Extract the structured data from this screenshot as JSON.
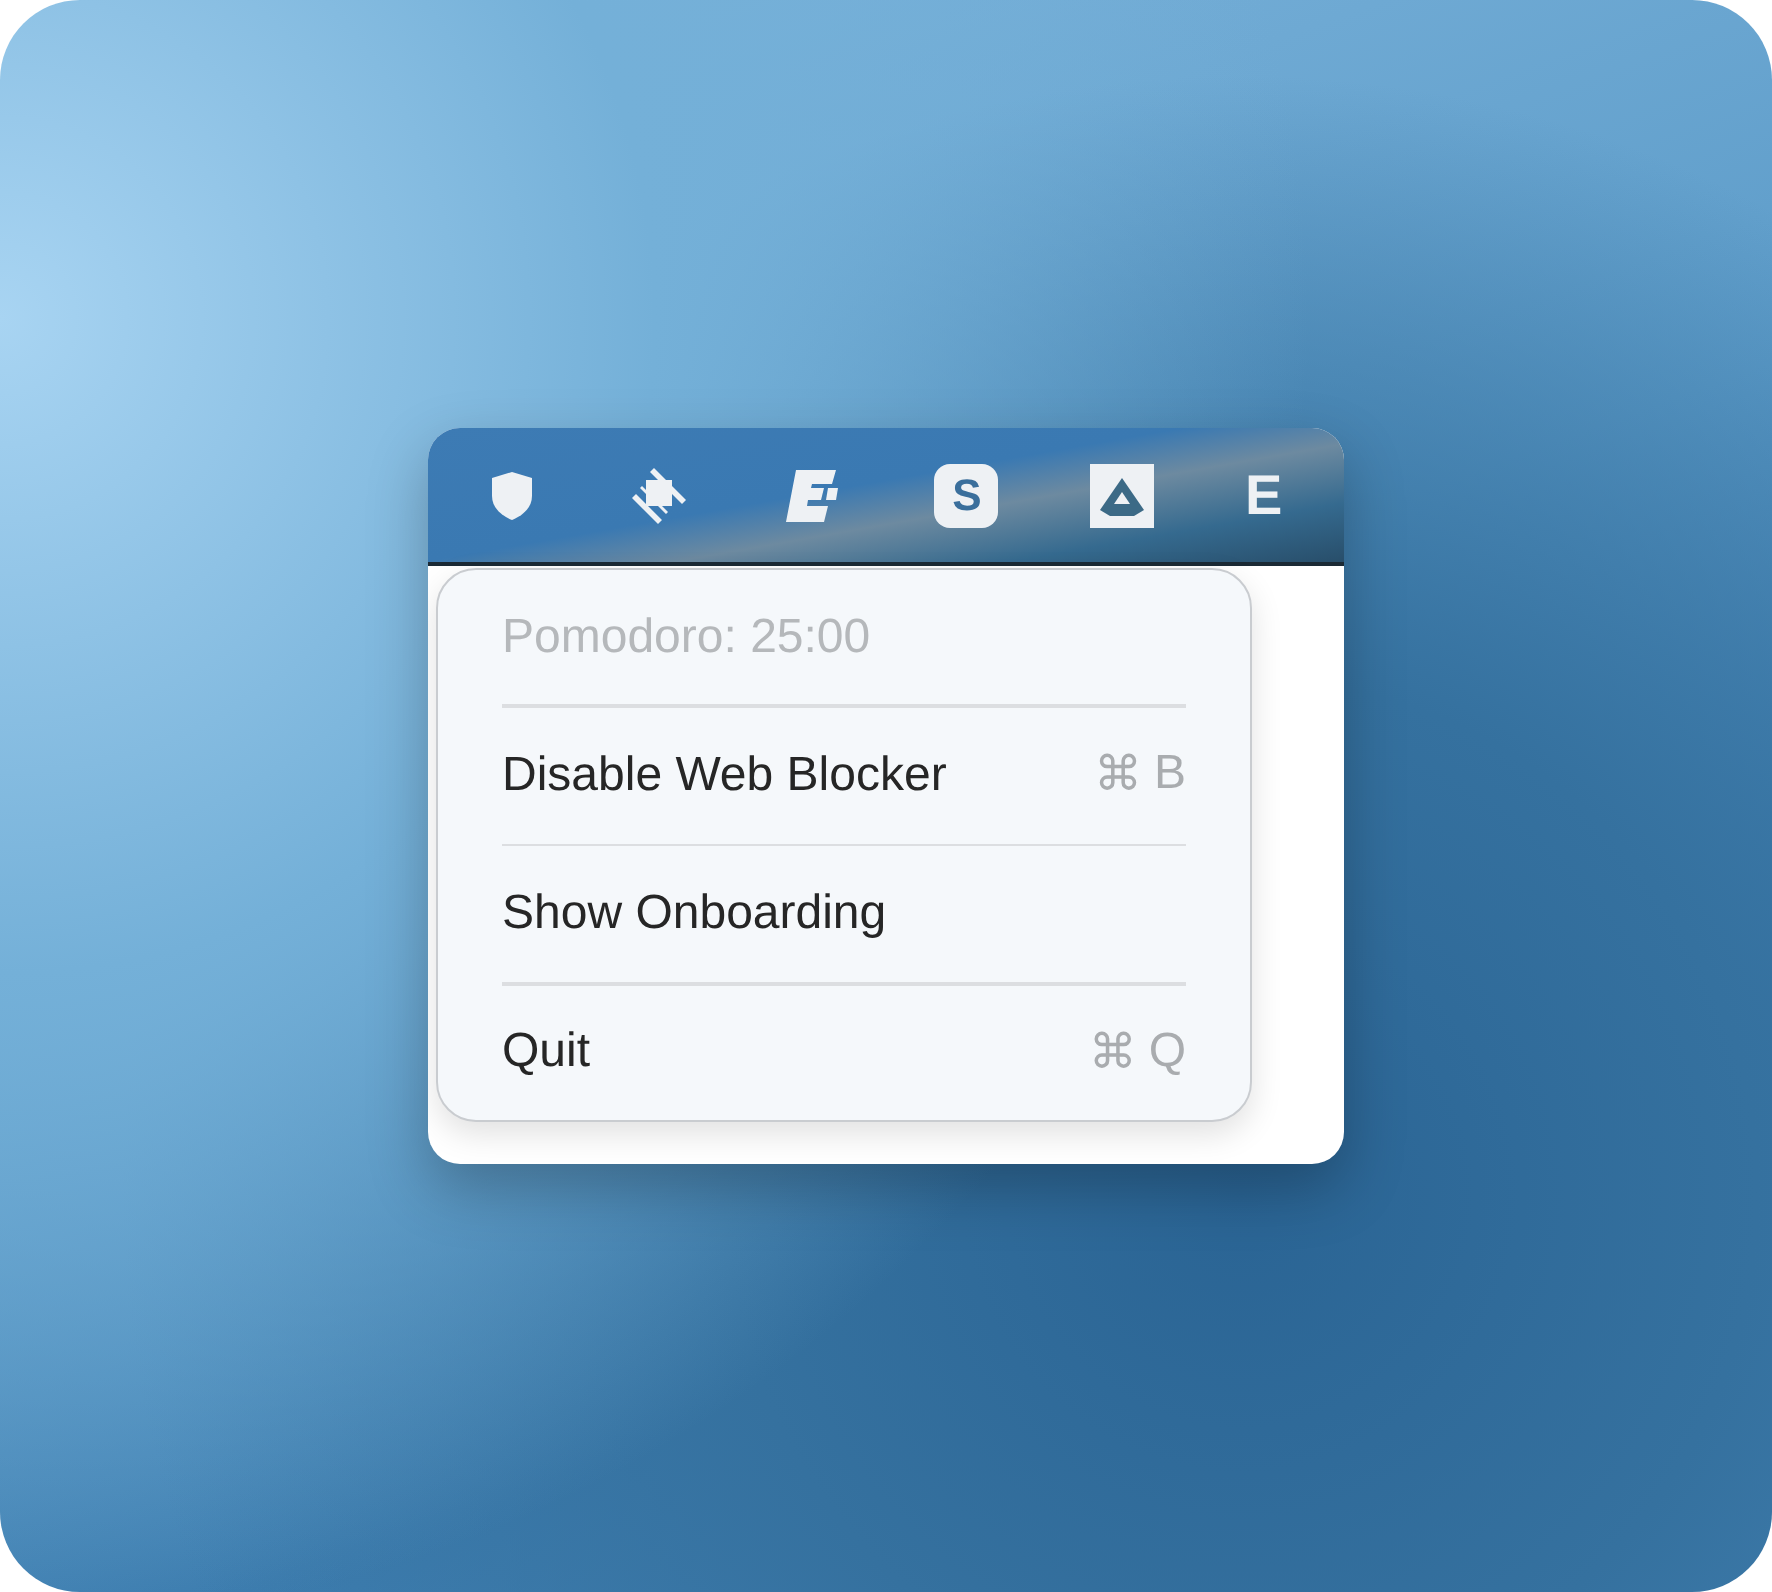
{
  "menu_bar": {
    "items": [
      {
        "kind": "shield"
      },
      {
        "kind": "diamond"
      },
      {
        "kind": "blocks"
      },
      {
        "kind": "badge",
        "text": "S"
      },
      {
        "kind": "triangle"
      },
      {
        "kind": "letter",
        "text": "E"
      }
    ]
  },
  "menu": {
    "items": [
      {
        "label": "Pomodoro: 25:00",
        "disabled": true
      },
      {
        "label": "Disable Web Blocker",
        "disabled": false,
        "shortcut_symbol": "⌘",
        "shortcut_key": "B"
      },
      {
        "label": "Show Onboarding",
        "disabled": false
      },
      {
        "label": "Quit",
        "disabled": false,
        "shortcut_symbol": "⌘",
        "shortcut_key": "Q"
      }
    ]
  }
}
